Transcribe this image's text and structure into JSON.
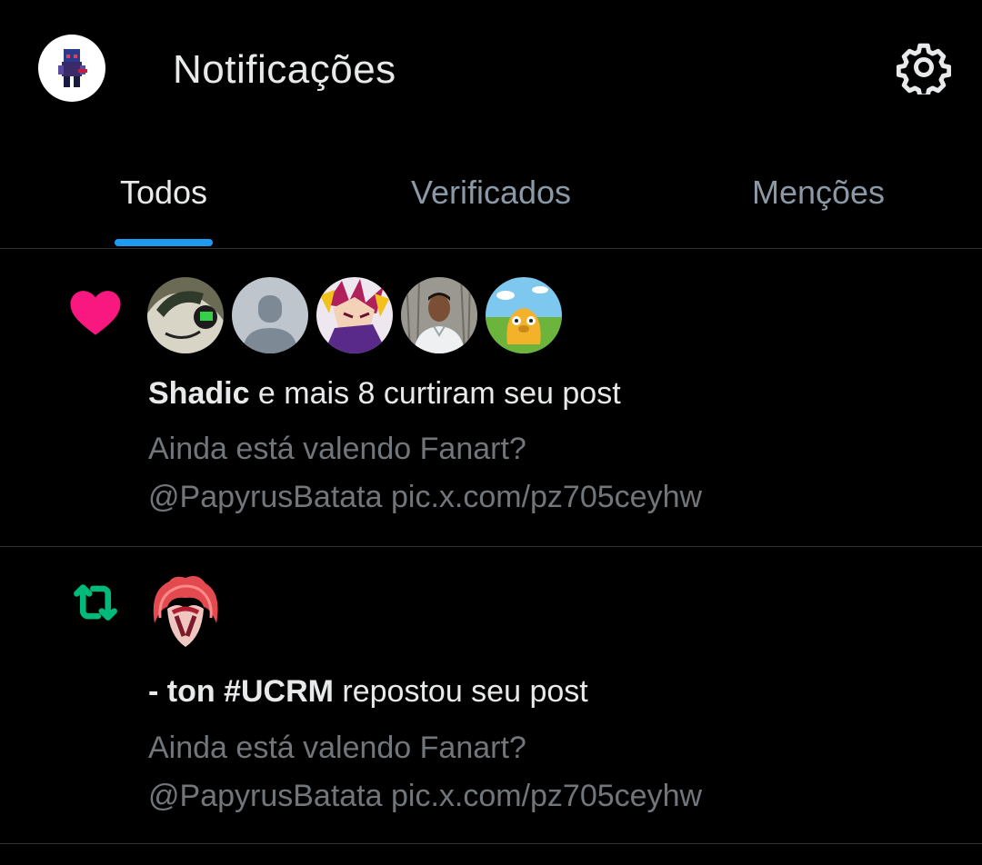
{
  "header": {
    "title": "Notificações",
    "settings_icon": "gear-icon",
    "avatar_icon": "pixel-character-avatar"
  },
  "tabs": [
    {
      "label": "Todos",
      "active": true
    },
    {
      "label": "Verificados",
      "active": false
    },
    {
      "label": "Menções",
      "active": false
    }
  ],
  "colors": {
    "background": "#000000",
    "accent": "#1d9bf0",
    "like": "#f91880",
    "repost": "#00ba7c",
    "muted_text": "#71767b"
  },
  "notifications": [
    {
      "type": "like",
      "icon": "heart-icon",
      "actor": "Shadic",
      "action": " e mais 8 curtiram seu post",
      "post_line1": "Ainda está valendo Fanart?",
      "post_line2": "@PapyrusBatata pic.x.com/pz705ceyhw",
      "avatars": [
        "shadic-avatar",
        "default-avatar",
        "anime-avatar",
        "photo-avatar",
        "jake-avatar"
      ]
    },
    {
      "type": "repost",
      "icon": "repost-icon",
      "actor": "- ton #UCRM",
      "action": " repostou seu post",
      "post_line1": "Ainda está valendo Fanart?",
      "post_line2": "@PapyrusBatata pic.x.com/pz705ceyhw",
      "avatars": [
        "red-hair-avatar"
      ]
    }
  ]
}
